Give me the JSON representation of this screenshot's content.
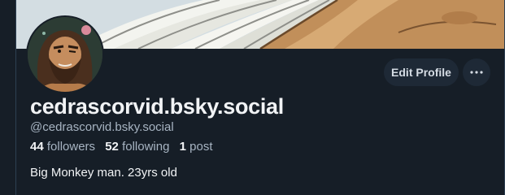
{
  "profile": {
    "display_name": "cedrascorvid.bsky.social",
    "handle": "@cedrascorvid.bsky.social",
    "bio": "Big Monkey man. 23yrs old"
  },
  "stats": {
    "followers_count": "44",
    "followers_label": "followers",
    "following_count": "52",
    "following_label": "following",
    "posts_count": "1",
    "posts_label": "post"
  },
  "actions": {
    "edit_profile_label": "Edit Profile",
    "more_icon": "ellipsis-icon"
  },
  "colors": {
    "background": "#161e27",
    "button_bg": "#1e2936",
    "text_primary": "#f1f3f5",
    "text_secondary": "#a7b4c2"
  }
}
